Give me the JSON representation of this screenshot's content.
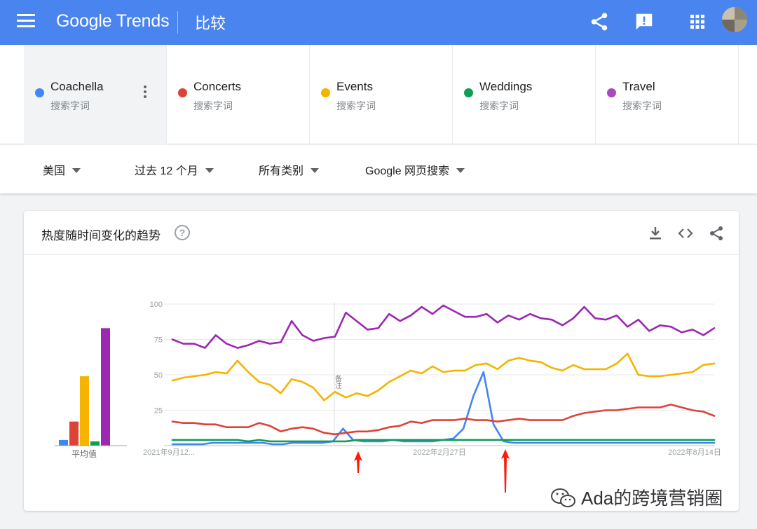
{
  "header": {
    "logo_text": "Google Trends",
    "page_title": "比较",
    "color": "#4a84ee"
  },
  "terms": [
    {
      "name": "Coachella",
      "sub": "搜索字词",
      "color": "#4285f4",
      "active": true
    },
    {
      "name": "Concerts",
      "sub": "搜索字词",
      "color": "#db4437",
      "active": false
    },
    {
      "name": "Events",
      "sub": "搜索字词",
      "color": "#f4b400",
      "active": false
    },
    {
      "name": "Weddings",
      "sub": "搜索字词",
      "color": "#0f9d58",
      "active": false
    },
    {
      "name": "Travel",
      "sub": "搜索字词",
      "color": "#ab47bc",
      "active": false
    }
  ],
  "filters": {
    "region": "美国",
    "time": "过去 12 个月",
    "category": "所有类别",
    "search_type": "Google 网页搜索"
  },
  "card": {
    "title": "热度随时间变化的趋势",
    "help_icon": "help-circle-icon",
    "icons": [
      "download-icon",
      "embed-code-icon",
      "share-icon"
    ]
  },
  "chart_data": {
    "type": "line",
    "yticks": [
      25,
      50,
      75,
      100
    ],
    "ylim": [
      0,
      100
    ],
    "xtick_labels": [
      "2021年9月12...",
      "2022年2月27日",
      "2022年8月14日"
    ],
    "note_label": "备注",
    "average_label": "平均值",
    "averages": [
      {
        "name": "Coachella",
        "value": 4
      },
      {
        "name": "Concerts",
        "value": 17
      },
      {
        "name": "Events",
        "value": 49
      },
      {
        "name": "Weddings",
        "value": 3
      },
      {
        "name": "Travel",
        "value": 83
      }
    ],
    "series": [
      {
        "name": "Coachella",
        "color": "#4285f4",
        "values": [
          1,
          1,
          1,
          1,
          2,
          2,
          2,
          2,
          2,
          2,
          1,
          1,
          2,
          2,
          2,
          2,
          3,
          12,
          4,
          3,
          3,
          3,
          4,
          3,
          3,
          3,
          3,
          4,
          5,
          12,
          35,
          52,
          15,
          3,
          2,
          2,
          2,
          2,
          2,
          2,
          2,
          2,
          2,
          2,
          2,
          2,
          2,
          2,
          2,
          2,
          2,
          2,
          2,
          2,
          2
        ]
      },
      {
        "name": "Concerts",
        "color": "#db4437",
        "values": [
          17,
          16,
          16,
          15,
          15,
          13,
          13,
          13,
          16,
          14,
          10,
          12,
          13,
          12,
          9,
          8,
          9,
          10,
          10,
          11,
          13,
          14,
          17,
          16,
          18,
          18,
          18,
          19,
          18,
          18,
          17,
          18,
          19,
          18,
          18,
          18,
          18,
          21,
          23,
          24,
          25,
          25,
          26,
          27,
          27,
          27,
          29,
          27,
          25,
          24,
          21
        ]
      },
      {
        "name": "Events",
        "color": "#f4b400",
        "values": [
          46,
          48,
          49,
          50,
          52,
          51,
          60,
          52,
          45,
          43,
          37,
          47,
          45,
          41,
          32,
          38,
          34,
          37,
          35,
          39,
          45,
          49,
          53,
          51,
          56,
          52,
          53,
          53,
          57,
          58,
          54,
          60,
          62,
          60,
          59,
          55,
          53,
          57,
          54,
          54,
          54,
          58,
          65,
          50,
          49,
          49,
          50,
          51,
          52,
          57,
          58
        ]
      },
      {
        "name": "Weddings",
        "color": "#0f9d58",
        "values": [
          4,
          4,
          4,
          4,
          4,
          4,
          4,
          3,
          4,
          3,
          3,
          3,
          3,
          3,
          3,
          3,
          3,
          4,
          4,
          4,
          4,
          4,
          4,
          4,
          4,
          4,
          4,
          4,
          4,
          4,
          4,
          4,
          4,
          4,
          4,
          4,
          4,
          4,
          4,
          4,
          4,
          4,
          4,
          4,
          4,
          4,
          4,
          4,
          4,
          4,
          4
        ]
      },
      {
        "name": "Travel",
        "color": "#9c27b0",
        "values": [
          75,
          72,
          72,
          69,
          78,
          72,
          69,
          71,
          74,
          72,
          73,
          88,
          78,
          74,
          76,
          77,
          94,
          88,
          82,
          83,
          93,
          88,
          92,
          98,
          93,
          99,
          95,
          91,
          91,
          93,
          87,
          92,
          89,
          93,
          90,
          89,
          85,
          90,
          98,
          90,
          89,
          92,
          84,
          89,
          81,
          85,
          84,
          80,
          82,
          78,
          83
        ]
      }
    ]
  },
  "watermark": {
    "text": "Ada的跨境营销圈",
    "icon": "wechat-icon"
  }
}
